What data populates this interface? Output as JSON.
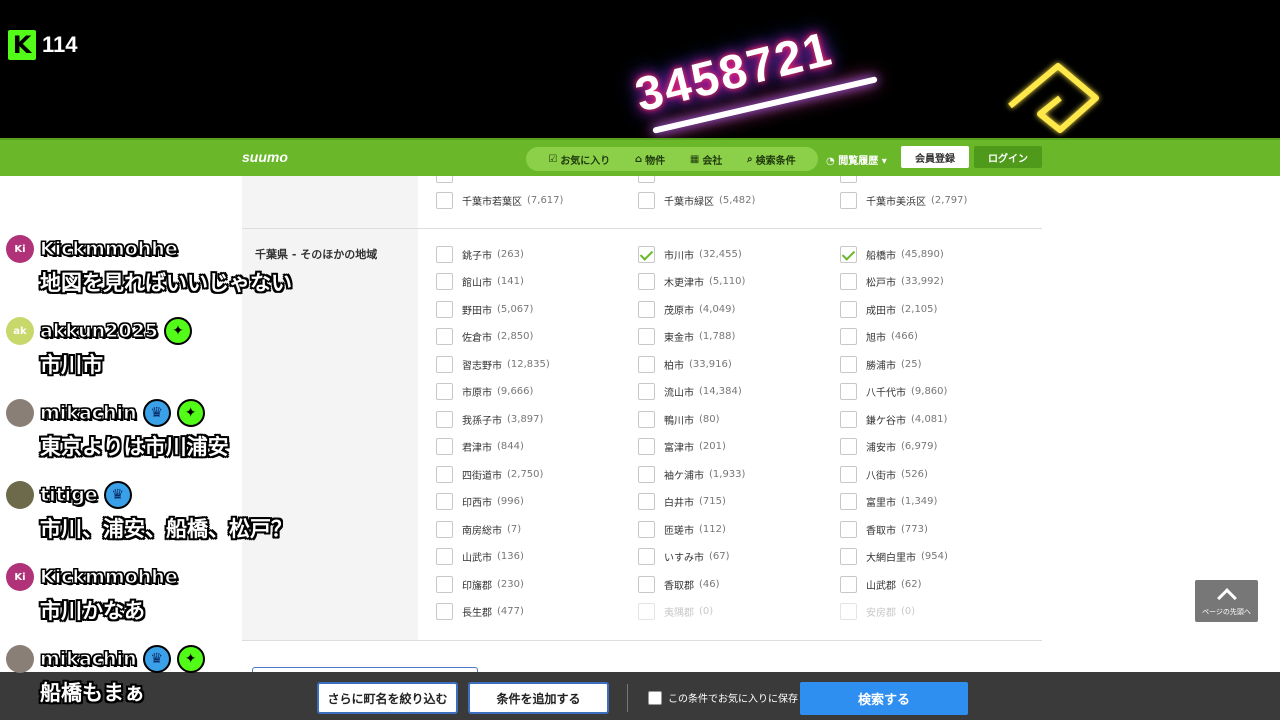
{
  "stream": {
    "viewer_count": "114",
    "kick_logo": "K",
    "neon_number": "3458721"
  },
  "header": {
    "logo": "suumo",
    "nav": [
      {
        "icon": "checkbox-icon",
        "label": "お気に入り"
      },
      {
        "icon": "house-icon",
        "label": "物件"
      },
      {
        "icon": "building-icon",
        "label": "会社"
      },
      {
        "icon": "search-icon",
        "label": "検索条件"
      }
    ],
    "history_label": "閲覧履歴",
    "register_label": "会員登録",
    "login_label": "ログイン"
  },
  "search_form": {
    "region_label": "千葉県 - そのほかの地域",
    "top_row": [
      {
        "name": "千葉市若葉区",
        "count": "(7,617)",
        "checked": false
      },
      {
        "name": "千葉市緑区",
        "count": "(5,482)",
        "checked": false
      },
      {
        "name": "千葉市美浜区",
        "count": "(2,797)",
        "checked": false
      }
    ],
    "cities": [
      [
        {
          "name": "銚子市",
          "count": "(263)",
          "checked": false
        },
        {
          "name": "館山市",
          "count": "(141)",
          "checked": false
        },
        {
          "name": "野田市",
          "count": "(5,067)",
          "checked": false
        },
        {
          "name": "佐倉市",
          "count": "(2,850)",
          "checked": false
        },
        {
          "name": "習志野市",
          "count": "(12,835)",
          "checked": false
        },
        {
          "name": "市原市",
          "count": "(9,666)",
          "checked": false
        },
        {
          "name": "我孫子市",
          "count": "(3,897)",
          "checked": false
        },
        {
          "name": "君津市",
          "count": "(844)",
          "checked": false
        },
        {
          "name": "四街道市",
          "count": "(2,750)",
          "checked": false
        },
        {
          "name": "印西市",
          "count": "(996)",
          "checked": false
        },
        {
          "name": "南房総市",
          "count": "(7)",
          "checked": false
        },
        {
          "name": "山武市",
          "count": "(136)",
          "checked": false
        },
        {
          "name": "印旛郡",
          "count": "(230)",
          "checked": false
        },
        {
          "name": "長生郡",
          "count": "(477)",
          "checked": false
        }
      ],
      [
        {
          "name": "市川市",
          "count": "(32,455)",
          "checked": true
        },
        {
          "name": "木更津市",
          "count": "(5,110)",
          "checked": false
        },
        {
          "name": "茂原市",
          "count": "(4,049)",
          "checked": false
        },
        {
          "name": "東金市",
          "count": "(1,788)",
          "checked": false
        },
        {
          "name": "柏市",
          "count": "(33,916)",
          "checked": false
        },
        {
          "name": "流山市",
          "count": "(14,384)",
          "checked": false
        },
        {
          "name": "鴨川市",
          "count": "(80)",
          "checked": false
        },
        {
          "name": "富津市",
          "count": "(201)",
          "checked": false
        },
        {
          "name": "袖ケ浦市",
          "count": "(1,933)",
          "checked": false
        },
        {
          "name": "白井市",
          "count": "(715)",
          "checked": false
        },
        {
          "name": "匝瑳市",
          "count": "(112)",
          "checked": false
        },
        {
          "name": "いすみ市",
          "count": "(67)",
          "checked": false
        },
        {
          "name": "香取郡",
          "count": "(46)",
          "checked": false
        },
        {
          "name": "夷隅郡",
          "count": "(0)",
          "checked": false,
          "disabled": true
        }
      ],
      [
        {
          "name": "船橋市",
          "count": "(45,890)",
          "checked": true
        },
        {
          "name": "松戸市",
          "count": "(33,992)",
          "checked": false
        },
        {
          "name": "成田市",
          "count": "(2,105)",
          "checked": false
        },
        {
          "name": "旭市",
          "count": "(466)",
          "checked": false
        },
        {
          "name": "勝浦市",
          "count": "(25)",
          "checked": false
        },
        {
          "name": "八千代市",
          "count": "(9,860)",
          "checked": false
        },
        {
          "name": "鎌ケ谷市",
          "count": "(4,081)",
          "checked": false
        },
        {
          "name": "浦安市",
          "count": "(6,979)",
          "checked": false
        },
        {
          "name": "八街市",
          "count": "(526)",
          "checked": false
        },
        {
          "name": "富里市",
          "count": "(1,349)",
          "checked": false
        },
        {
          "name": "香取市",
          "count": "(773)",
          "checked": false
        },
        {
          "name": "大網白里市",
          "count": "(954)",
          "checked": false
        },
        {
          "name": "山武郡",
          "count": "(62)",
          "checked": false
        },
        {
          "name": "安房郡",
          "count": "(0)",
          "checked": false,
          "disabled": true
        }
      ]
    ]
  },
  "page_top_label": "ページの先頭へ",
  "bottom_bar": {
    "refine_label": "さらに町名を絞り込む",
    "add_condition_label": "条件を追加する",
    "save_label": "この条件でお気に入りに保存",
    "search_label": "検索する"
  },
  "chat": [
    {
      "user": "Kickmmohhe",
      "avatar_text": "Ki",
      "avatar_color": "#b0337a",
      "badges": [],
      "text": "地図を見ればいいじゃない"
    },
    {
      "user": "akkun2025",
      "avatar_text": "ak",
      "avatar_color": "#c8d86a",
      "badges": [
        "star"
      ],
      "text": "市川市"
    },
    {
      "user": "mikachin",
      "avatar_text": "",
      "avatar_color": "#8a7f76",
      "badges": [
        "crown",
        "star"
      ],
      "text": "東京よりは市川浦安"
    },
    {
      "user": "titige",
      "avatar_text": "",
      "avatar_color": "#6c6a4a",
      "badges": [
        "crown"
      ],
      "text": "市川、浦安、船橋、松戸？"
    },
    {
      "user": "Kickmmohhe",
      "avatar_text": "Ki",
      "avatar_color": "#b0337a",
      "badges": [],
      "text": "市川かなあ"
    },
    {
      "user": "mikachin",
      "avatar_text": "",
      "avatar_color": "#8a7f76",
      "badges": [
        "crown",
        "star"
      ],
      "text": "船橋もまぁ"
    }
  ]
}
